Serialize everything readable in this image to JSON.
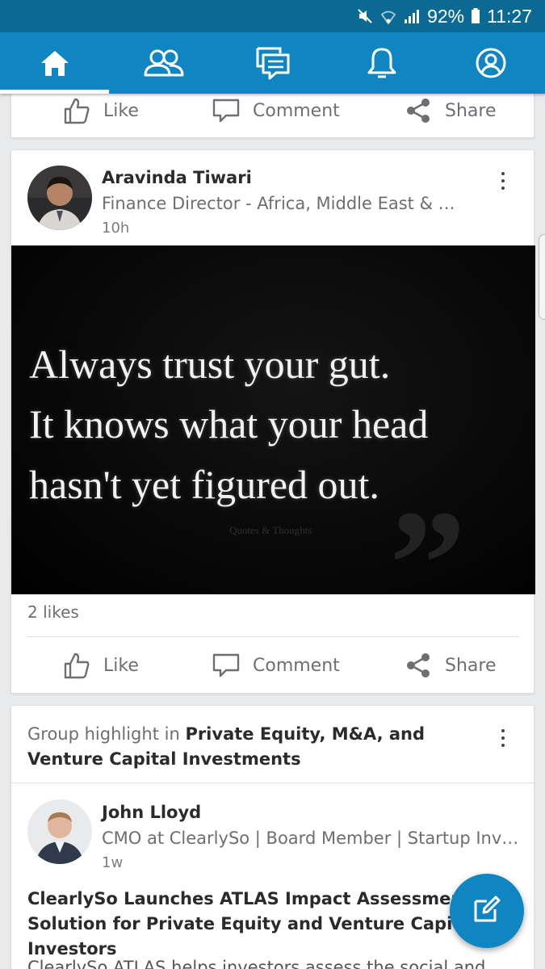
{
  "status_bar": {
    "battery": "92%",
    "time": "11:27"
  },
  "nav": {
    "items": [
      {
        "name": "home",
        "icon": "home-icon",
        "active": true
      },
      {
        "name": "my-network",
        "icon": "people-icon"
      },
      {
        "name": "messaging",
        "icon": "messages-icon"
      },
      {
        "name": "notifications",
        "icon": "bell-icon"
      },
      {
        "name": "me",
        "icon": "profile-icon"
      }
    ],
    "color": "#0f85c2"
  },
  "actions": {
    "like": "Like",
    "comment": "Comment",
    "share": "Share"
  },
  "post": {
    "author": "Aravinda Tiwari",
    "headline": "Finance Director - Africa, Middle East & S…",
    "time": "10h",
    "image_quote": {
      "line1": "Always trust your gut.",
      "line2": "It knows what your head",
      "line3": "hasn't yet figured out.",
      "watermark": "Quotes & Thoughts"
    },
    "likes": "2 likes"
  },
  "group_post": {
    "prefix": "Group highlight in ",
    "group_name": "Private Equity, M&A, and Venture Capital Investments",
    "author": "John Lloyd",
    "headline": "CMO at ClearlySo | Board Member | Startup Inves…",
    "time": "1w",
    "title": "ClearlySo Launches ATLAS Impact Assessment Solution for Private Equity and Venture Capital Investors",
    "body": "ClearlySo ATLAS helps investors assess the social and"
  }
}
